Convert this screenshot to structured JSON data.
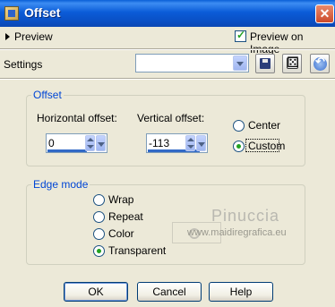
{
  "window": {
    "title": "Offset",
    "close_glyph": "✕"
  },
  "preview": {
    "label": "Preview",
    "preview_on_image_label": "Preview on Image",
    "preview_on_image_checked": true
  },
  "settings": {
    "label": "Settings",
    "preset_value": ""
  },
  "toolbar": {
    "save_icon": "save-disk-icon",
    "random_icon": "dice-icon",
    "reset_icon": "reset-icon"
  },
  "offset_group": {
    "legend": "Offset",
    "horizontal_label": "Horizontal offset:",
    "horizontal_value": "0",
    "vertical_label": "Vertical offset:",
    "vertical_value": "-113",
    "options": [
      {
        "label": "Center",
        "selected": false
      },
      {
        "label": "Custom",
        "selected": true
      }
    ]
  },
  "edge_group": {
    "legend": "Edge mode",
    "options": [
      {
        "label": "Wrap",
        "selected": false
      },
      {
        "label": "Repeat",
        "selected": false
      },
      {
        "label": "Color",
        "selected": false
      },
      {
        "label": "Transparent",
        "selected": true
      }
    ]
  },
  "watermark": {
    "name": "Pinuccia",
    "url": "www.maidiregrafica.eu"
  },
  "buttons": {
    "ok": "OK",
    "cancel": "Cancel",
    "help": "Help"
  },
  "colors": {
    "title_bar": "#0a5fd6",
    "group_label": "#0046d5",
    "radio_dot": "#21a121",
    "dialog_bg": "#ece9d8"
  }
}
